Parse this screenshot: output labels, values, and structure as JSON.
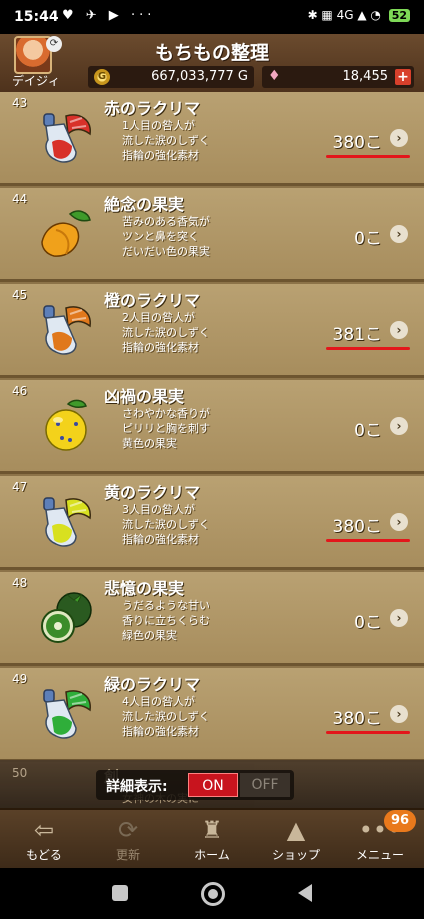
{
  "status_bar": {
    "time": "15:44",
    "left_icons": "♥ ✈ ▶ ···",
    "right_icons": "✱ ▦ 4G ▲ ◔",
    "battery": "52"
  },
  "header": {
    "title": "もちもの整理",
    "username": "デイジィ",
    "gold_symbol": "G",
    "gold": "667,033,777 G",
    "gems": "18,455",
    "plus_label": "+"
  },
  "items": [
    {
      "number": "43",
      "name": "赤のラクリマ",
      "desc": [
        "1人目の咎人が",
        "流した涙のしずく",
        "指輪の強化素材"
      ],
      "count": "380こ",
      "highlighted": true,
      "icon": "red-lacrima-icon",
      "color": "#d8312a"
    },
    {
      "number": "44",
      "name": "絶念の果実",
      "desc": [
        "苦みのある香気が",
        "ツンと鼻を突く",
        "だいだい色の果実"
      ],
      "count": "0こ",
      "highlighted": false,
      "icon": "orange-fruit-icon",
      "color": "#f0a11b"
    },
    {
      "number": "45",
      "name": "橙のラクリマ",
      "desc": [
        "2人目の咎人が",
        "流した涙のしずく",
        "指輪の強化素材"
      ],
      "count": "381こ",
      "highlighted": true,
      "icon": "orange-lacrima-icon",
      "color": "#e0781c"
    },
    {
      "number": "46",
      "name": "凶禍の果実",
      "desc": [
        "さわやかな香りが",
        "ピリリと胸を刺す",
        "黄色の果実"
      ],
      "count": "0こ",
      "highlighted": false,
      "icon": "yellow-fruit-icon",
      "color": "#f3d21b"
    },
    {
      "number": "47",
      "name": "黄のラクリマ",
      "desc": [
        "3人目の咎人が",
        "流した涙のしずく",
        "指輪の強化素材"
      ],
      "count": "380こ",
      "highlighted": true,
      "icon": "yellow-lacrima-icon",
      "color": "#d8e020"
    },
    {
      "number": "48",
      "name": "悲憶の果実",
      "desc": [
        "うだるような甘い",
        "香りに立ちくらむ",
        "緑色の果実"
      ],
      "count": "0こ",
      "highlighted": false,
      "icon": "green-fruit-icon",
      "color": "#3b8c2a"
    },
    {
      "number": "49",
      "name": "緑のラクリマ",
      "desc": [
        "4人目の咎人が",
        "流した涙のしずく",
        "指輪の強化素材"
      ],
      "count": "380こ",
      "highlighted": true,
      "icon": "green-lacrima-icon",
      "color": "#2fae3a"
    }
  ],
  "partial_item": {
    "number": "50",
    "name": "創",
    "desc": "女神の木の実に"
  },
  "detail_toggle": {
    "label": "詳細表示:",
    "on": "ON",
    "off": "OFF"
  },
  "bottom_nav": {
    "back": "もどる",
    "refresh": "更新",
    "home": "ホーム",
    "shop": "ショップ",
    "menu": "メニュー",
    "menu_badge": "96"
  }
}
